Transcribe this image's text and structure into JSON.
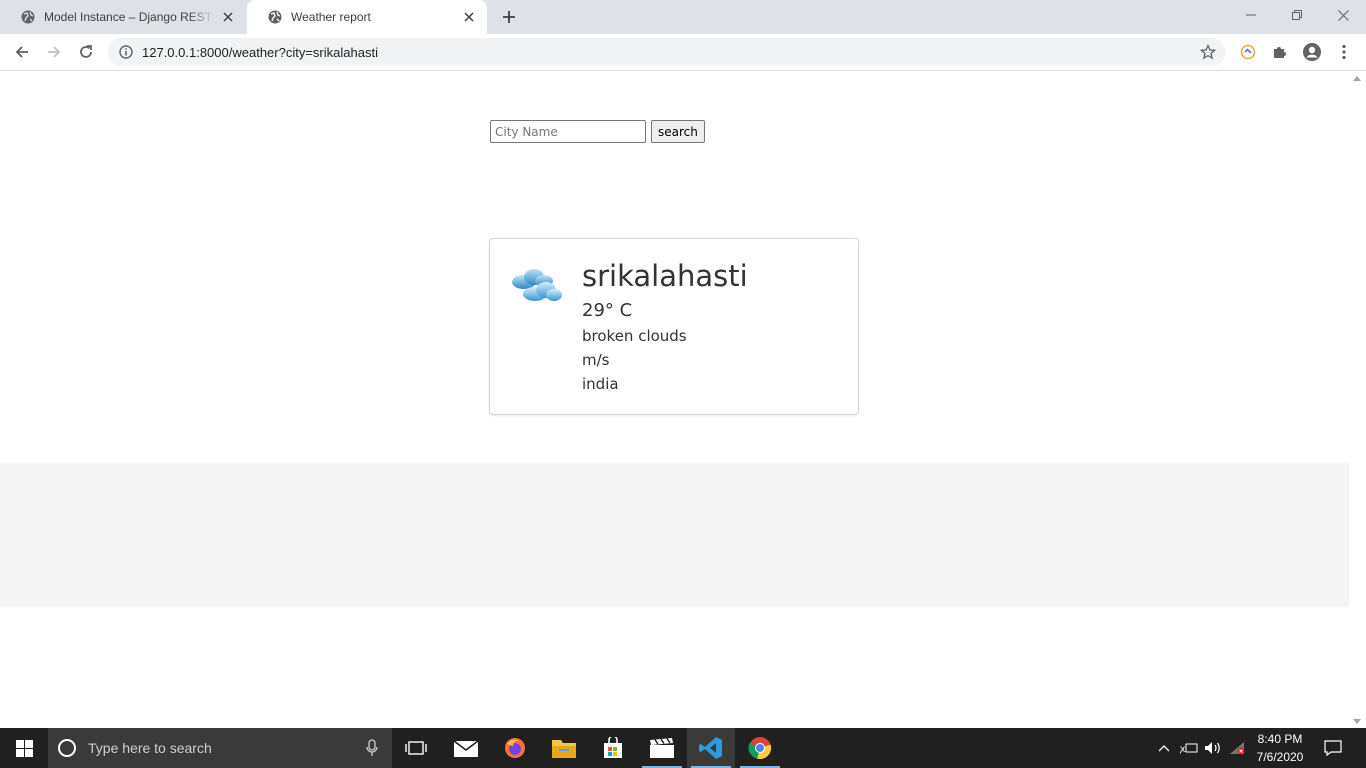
{
  "browser": {
    "tabs": [
      {
        "title": "Model Instance – Django REST framework",
        "active": false
      },
      {
        "title": "Weather report",
        "active": true
      }
    ],
    "url": "127.0.0.1:8000/weather?city=srikalahasti"
  },
  "page": {
    "search": {
      "placeholder": "City Name",
      "value": "",
      "button_label": "search"
    },
    "weather": {
      "icon": "broken-clouds-icon",
      "city": "srikalahasti",
      "temperature": "29° C",
      "description": "broken clouds",
      "wind": "m/s",
      "country": "india"
    }
  },
  "taskbar": {
    "search_placeholder": "Type here to search",
    "time": "8:40 PM",
    "date": "7/6/2020"
  },
  "colors": {
    "tabstrip": "#dee1e6",
    "omnibox": "#f1f3f4",
    "band": "#f4f4f4",
    "taskbar": "#202020"
  }
}
